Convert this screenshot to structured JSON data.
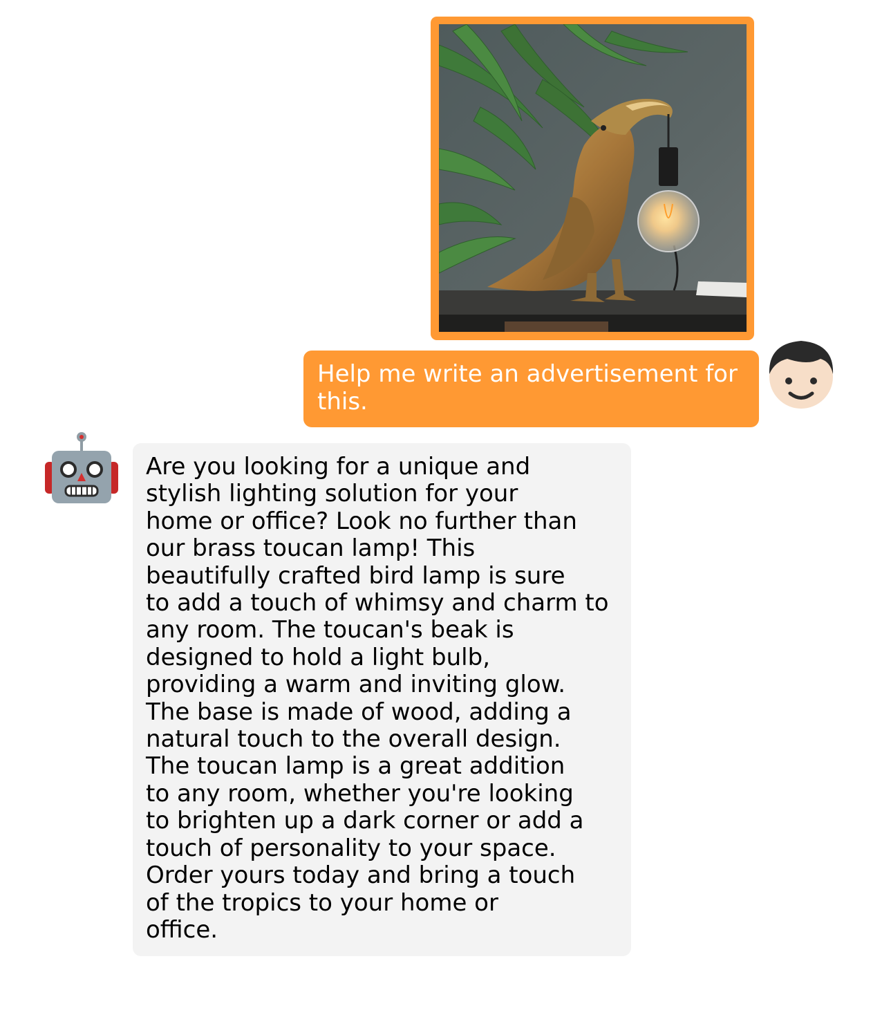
{
  "conversation": {
    "messages": [
      {
        "role": "user",
        "image": {
          "subject": "brass toucan table lamp holding a bulb, fern leaves behind",
          "frame_color": "#ff9933"
        },
        "text": "Help me write an advertisement for\nthis.",
        "bubble_color": "#ff9933",
        "text_color": "#ffffff",
        "avatar_icon": "boy-face-icon"
      },
      {
        "role": "assistant",
        "text": "Are you looking for a unique and\nstylish lighting solution for your\nhome or office? Look no further than\nour brass toucan lamp! This\nbeautifully crafted bird lamp is sure\nto add a touch of whimsy and charm to\nany room. The toucan's beak is\ndesigned to hold a light bulb,\nproviding a warm and inviting glow.\nThe base is made of wood, adding a\nnatural touch to the overall design.\nThe toucan lamp is a great addition\nto any room, whether you're looking\nto brighten up a dark corner or add a\ntouch of personality to your space.\nOrder yours today and bring a touch\nof the tropics to your home or\noffice.",
        "bubble_color": "#f3f3f3",
        "text_color": "#000000",
        "avatar_icon": "robot-face-icon"
      }
    ]
  }
}
